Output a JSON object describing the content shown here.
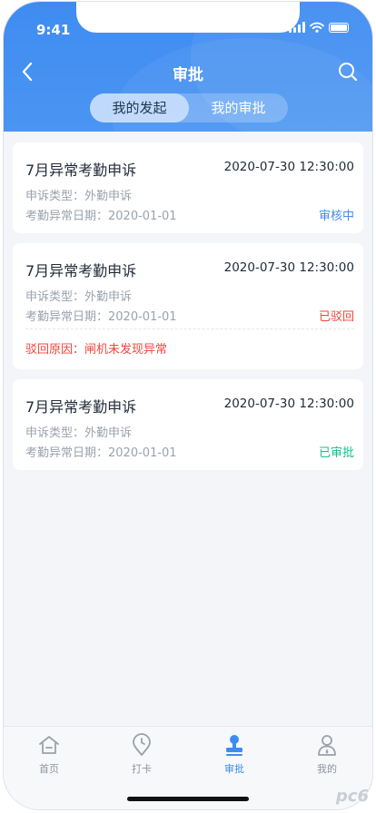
{
  "status_bar": {
    "time": "9:41"
  },
  "nav": {
    "title": "审批"
  },
  "segments": [
    {
      "label": "我的发起",
      "active": true
    },
    {
      "label": "我的审批",
      "active": false
    }
  ],
  "records": [
    {
      "title": "7月异常考勤申诉",
      "time": "2020-07-30 12:30:00",
      "type": "申诉类型：外勤申诉",
      "date": "考勤异常日期：2020-01-01",
      "status": "审核中",
      "status_color": "#3f8cf1"
    },
    {
      "title": "7月异常考勤申诉",
      "time": "2020-07-30 12:30:00",
      "type": "申诉类型：外勤申诉",
      "date": "考勤异常日期：2020-01-01",
      "status": "已驳回",
      "status_color": "#f0463e",
      "reason": "驳回原因：闸机未发现异常"
    },
    {
      "title": "7月异常考勤申诉",
      "time": "2020-07-30 12:30:00",
      "type": "申诉类型：外勤申诉",
      "date": "考勤异常日期：2020-01-01",
      "status": "已审批",
      "status_color": "#1bbf8a"
    }
  ],
  "tabbar": [
    {
      "label": "首页",
      "icon": "home-icon",
      "active": false
    },
    {
      "label": "打卡",
      "icon": "location-pin-icon",
      "active": false
    },
    {
      "label": "审批",
      "icon": "stamp-icon",
      "active": true
    },
    {
      "label": "我的",
      "icon": "person-icon",
      "active": false
    }
  ],
  "watermark": "pc6"
}
